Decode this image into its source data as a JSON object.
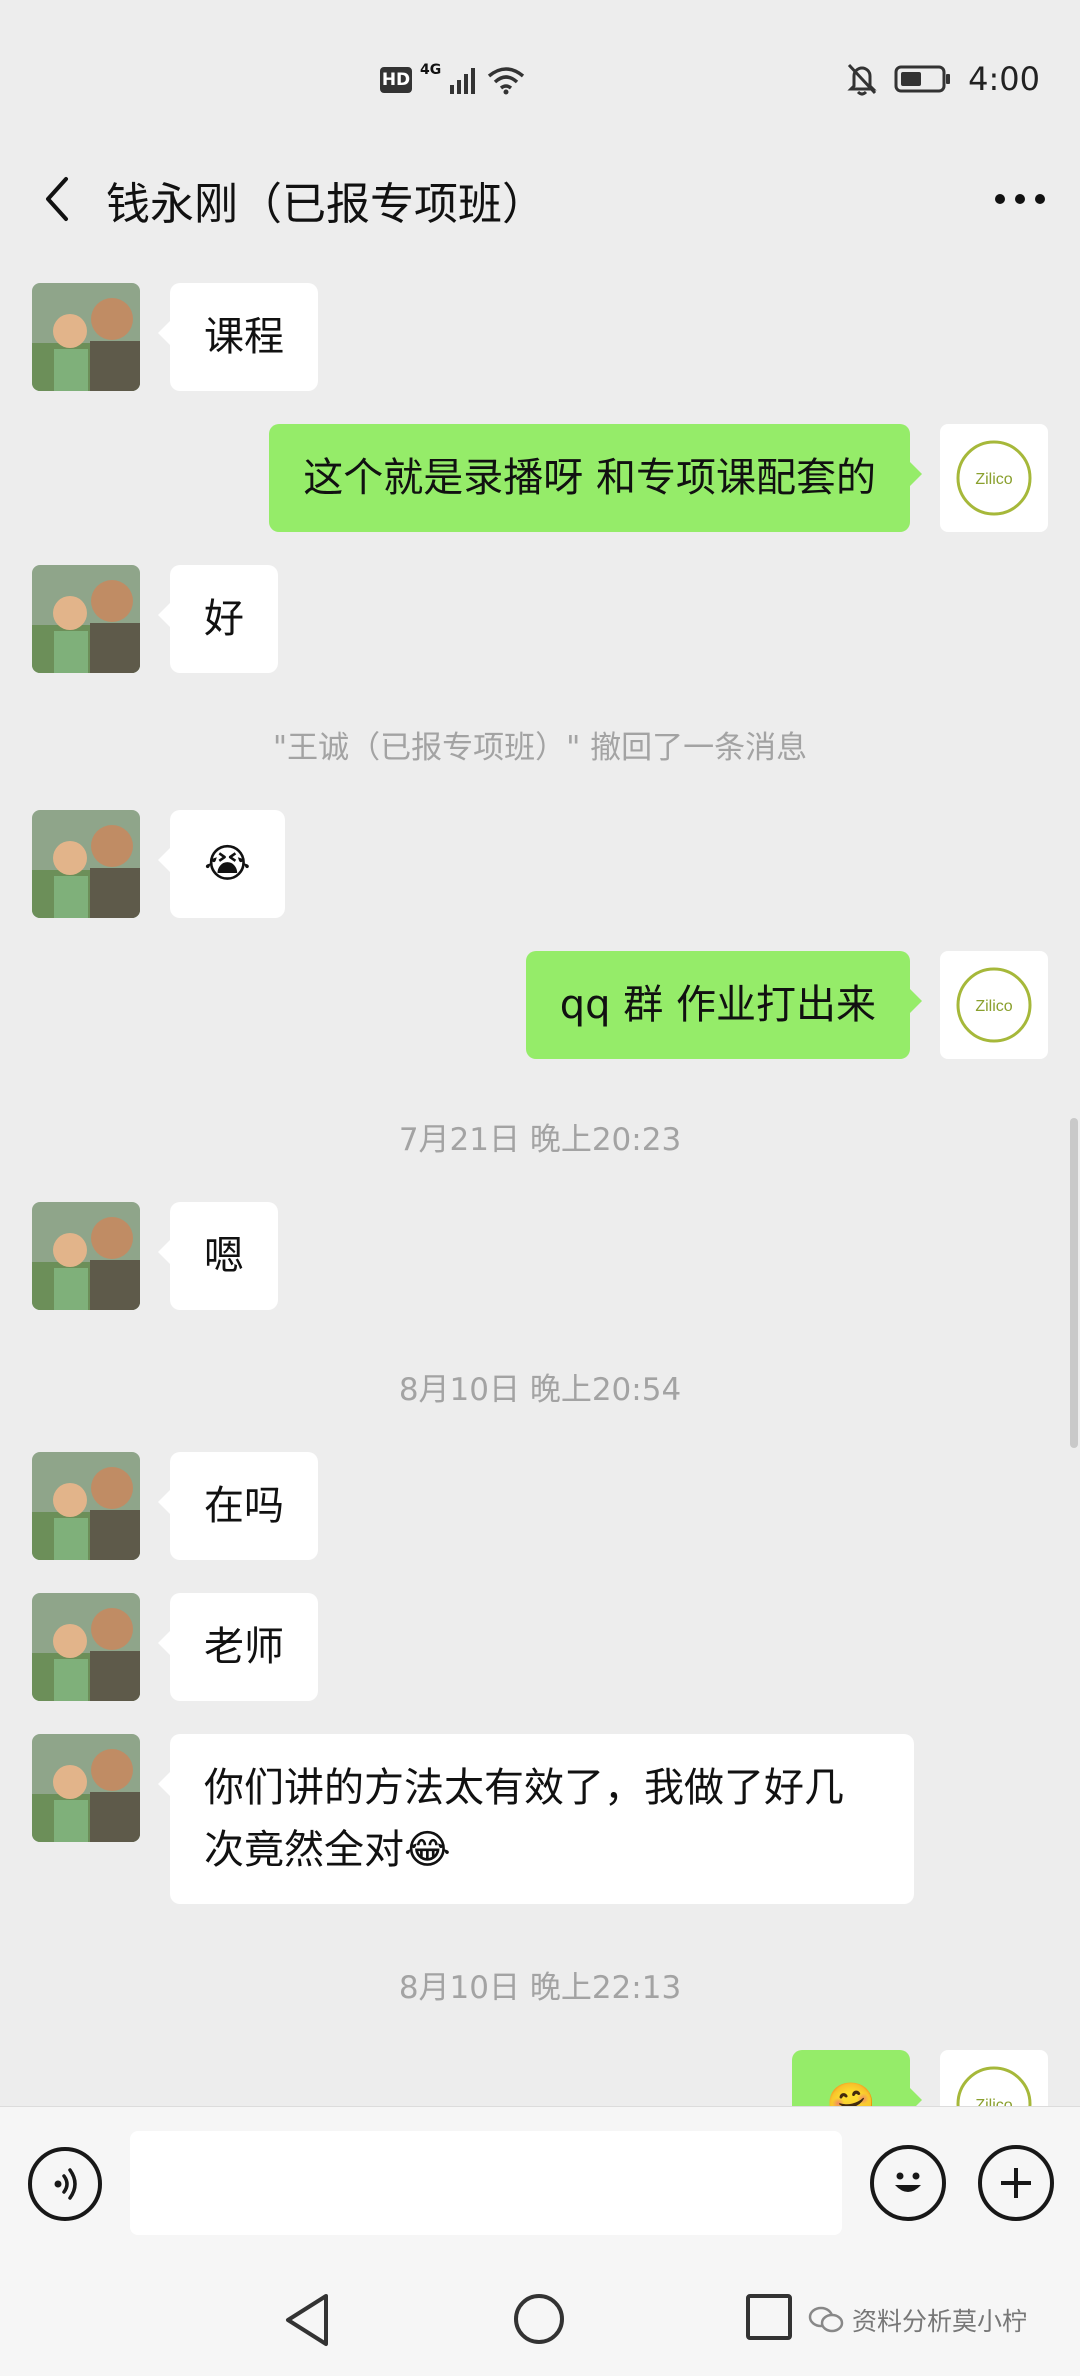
{
  "status_bar": {
    "hd": "HD",
    "network": "4G",
    "time": "4:00"
  },
  "header": {
    "title": "钱永刚（已报专项班）"
  },
  "messages": [
    {
      "text": "课程"
    },
    {
      "text": "这个就是录播呀  和专项课配套的"
    },
    {
      "text": "好"
    },
    {
      "text": "\"王诚（已报专项班）\" 撤回了一条消息"
    },
    {
      "emoji": "😭"
    },
    {
      "text": "qq 群  作业打出来"
    },
    {
      "text": "7月21日 晚上20:23"
    },
    {
      "text": "嗯"
    },
    {
      "text": "8月10日 晚上20:54"
    },
    {
      "text": "在吗"
    },
    {
      "text": "老师"
    },
    {
      "text": "你们讲的方法太有效了，我做了好几次竟然全对",
      "emoji": "😂"
    },
    {
      "text": "8月10日 晚上22:13"
    },
    {
      "emoji": "🤗"
    }
  ],
  "brand_avatar": {
    "text": "Zilico"
  },
  "input": {
    "placeholder": ""
  },
  "watermark": {
    "text": "资料分析莫小柠"
  },
  "colors": {
    "background": "#ededed",
    "incoming_bubble": "#ffffff",
    "outgoing_bubble": "#95ec69",
    "system_text": "#a3a3a3"
  },
  "icons": [
    "back-arrow-icon",
    "more-icon",
    "voice-icon",
    "emoji-icon",
    "plus-icon",
    "nav-back-icon",
    "nav-home-icon",
    "nav-recent-icon",
    "wechat-icon"
  ]
}
